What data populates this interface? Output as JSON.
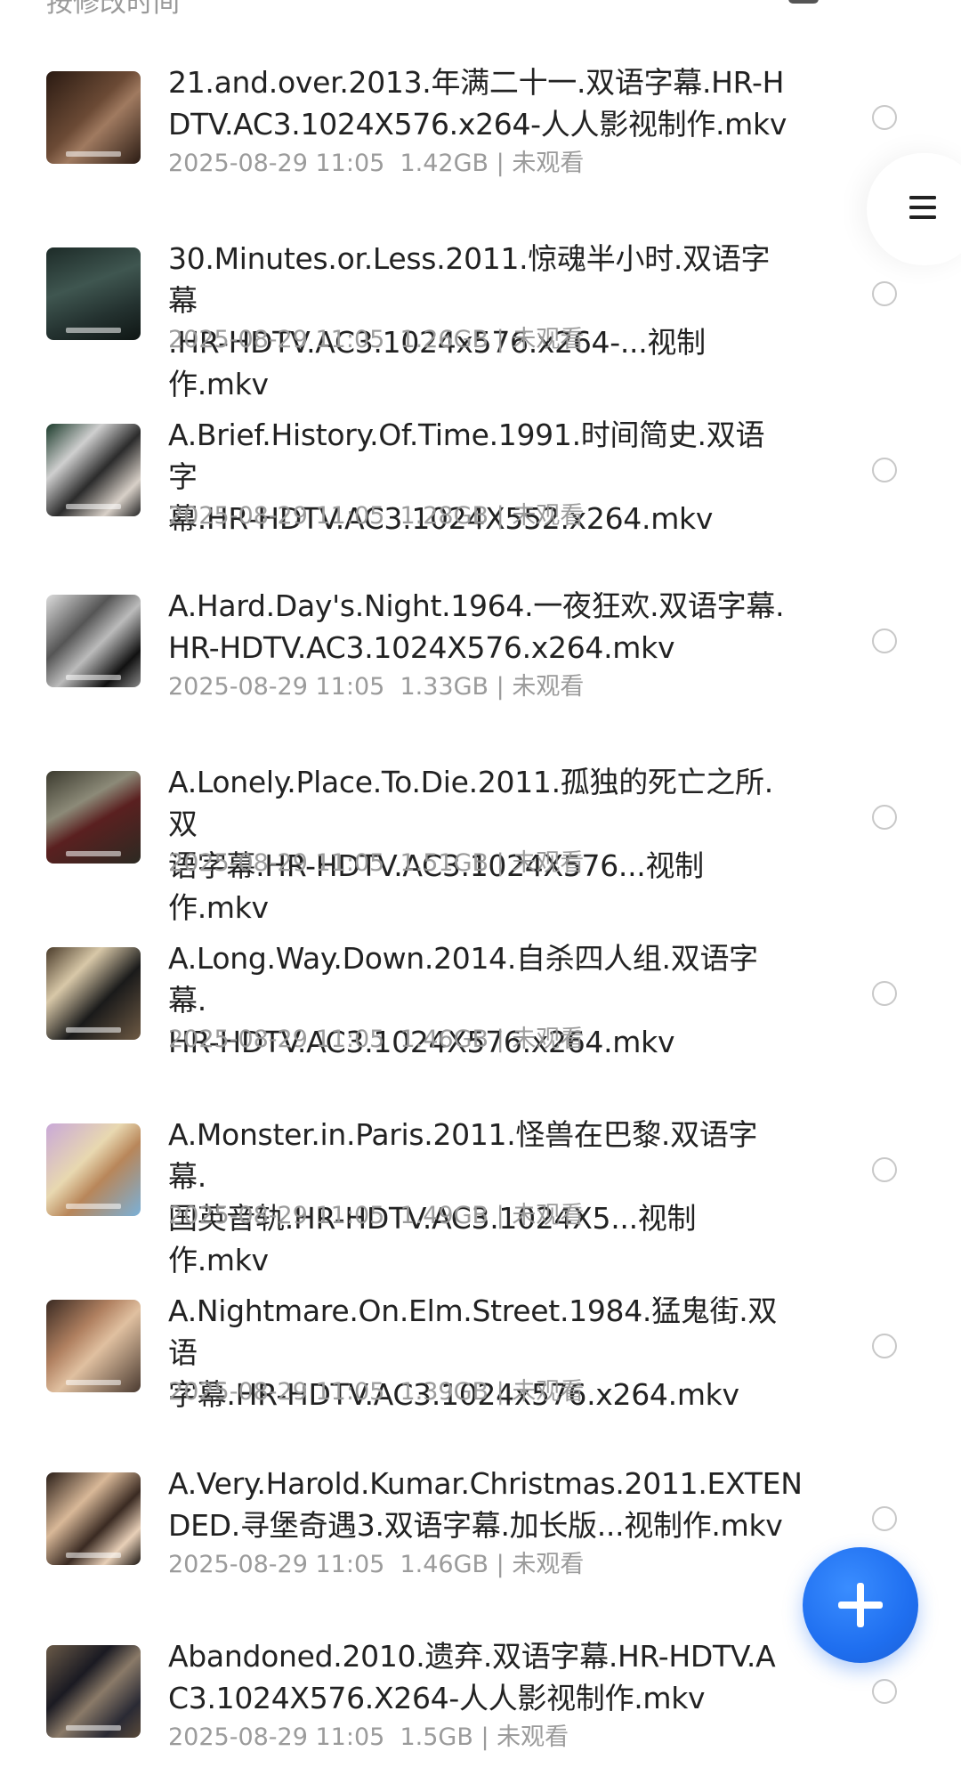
{
  "topbar": {
    "sort_label": "按修改时间"
  },
  "files": [
    {
      "title_line1": "21.and.over.2013.年满二十一.双语字幕.HR-H",
      "title_line2": "DTV.AC3.1024X576.x264-人人影视制作.mkv",
      "date": "2025-08-29 11:05",
      "size": "1.42GB",
      "status": "未观看"
    },
    {
      "title_line1": "30.Minutes.or.Less.2011.惊魂半小时.双语字幕",
      "title_line2": ".HR-HDTV.AC3.1024x576.x264-...视制作.mkv",
      "date": "2025-08-29 11:05",
      "size": "1.26GB",
      "status": "未观看"
    },
    {
      "title_line1": "A.Brief.History.Of.Time.1991.时间简史.双语字",
      "title_line2": "幕.HR-HDTV.AC3.1024X552.x264.mkv",
      "date": "2025-08-29 11:05",
      "size": "1.28GB",
      "status": "未观看"
    },
    {
      "title_line1": "A.Hard.Day's.Night.1964.一夜狂欢.双语字幕.",
      "title_line2": "HR-HDTV.AC3.1024X576.x264.mkv",
      "date": "2025-08-29 11:05",
      "size": "1.33GB",
      "status": "未观看"
    },
    {
      "title_line1": "A.Lonely.Place.To.Die.2011.孤独的死亡之所.双",
      "title_line2": "语字幕.HR-HDTV.AC3.1024X576...视制作.mkv",
      "date": "2025-08-29 11:05",
      "size": "1.51GB",
      "status": "未观看"
    },
    {
      "title_line1": "A.Long.Way.Down.2014.自杀四人组.双语字幕.",
      "title_line2": "HR-HDTV.AC3.1024X576.x264.mkv",
      "date": "2025-08-29 11:05",
      "size": "1.46GB",
      "status": "未观看"
    },
    {
      "title_line1": "A.Monster.in.Paris.2011.怪兽在巴黎.双语字幕.",
      "title_line2": "国英音轨.HR-HDTV.AC3.1024X5...视制作.mkv",
      "date": "2025-08-29 11:05",
      "size": "1.49GB",
      "status": "未观看"
    },
    {
      "title_line1": "A.Nightmare.On.Elm.Street.1984.猛鬼街.双语",
      "title_line2": "字幕.HR-HDTV.AC3.1024x576.x264.mkv",
      "date": "2025-08-29 11:05",
      "size": "1.39GB",
      "status": "未观看"
    },
    {
      "title_line1": "A.Very.Harold.Kumar.Christmas.2011.EXTEN",
      "title_line2": "DED.寻堡奇遇3.双语字幕.加长版...视制作.mkv",
      "date": "2025-08-29 11:05",
      "size": "1.46GB",
      "status": "未观看"
    },
    {
      "title_line1": "Abandoned.2010.遗弃.双语字幕.HR-HDTV.A",
      "title_line2": "C3.1024X576.X264-人人影视制作.mkv",
      "date": "2025-08-29 11:05",
      "size": "1.5GB",
      "status": "未观看"
    }
  ],
  "meta_separator": "|",
  "icons": {
    "select": "select-mode-icon",
    "grid": "grid-view-icon",
    "menu": "menu-icon",
    "add": "plus-icon"
  },
  "colors": {
    "accent": "#1f6ff0",
    "text_primary": "#222222",
    "text_secondary": "#9b9b9b"
  }
}
